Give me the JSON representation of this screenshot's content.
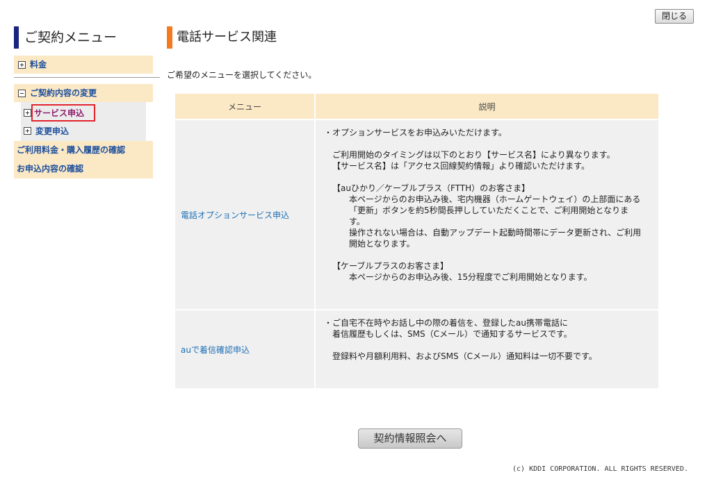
{
  "header": {
    "close_label": "閉じる"
  },
  "sidebar": {
    "title": "ご契約メニュー",
    "items": [
      {
        "label": "料金",
        "toggle": "plus"
      },
      {
        "label": "ご契約内容の変更",
        "toggle": "minus"
      }
    ],
    "sub_items": [
      {
        "label": "サービス申込",
        "active": true
      },
      {
        "label": "変更申込",
        "active": false
      }
    ],
    "links": [
      {
        "label": "ご利用料金・購入履歴の確認"
      },
      {
        "label": "お申込内容の確認"
      }
    ]
  },
  "main": {
    "title": "電話サービス関連",
    "instruction": "ご希望のメニューを選択してください。",
    "table": {
      "headers": [
        "メニュー",
        "説明"
      ],
      "rows": [
        {
          "menu": "電話オプションサービス申込",
          "desc": [
            "・オプションサービスをお申込みいただけます。",
            "ご利用開始のタイミングは以下のとおり【サービス名】により異なります。",
            "【サービス名】は「アクセス回線契約情報」より確認いただけます。",
            "【auひかり／ケーブルプラス（FTTH）のお客さま】",
            "本ページからのお申込み後、宅内機器（ホームゲートウェイ）の上部面にある",
            "「更新」ボタンを約5秒間長押ししていただくことで、ご利用開始となりま",
            "す。",
            "操作されない場合は、自動アップデート起動時間帯にデータ更新され、ご利用",
            "開始となります。",
            "【ケーブルプラスのお客さま】",
            "本ページからのお申込み後、15分程度でご利用開始となります。"
          ]
        },
        {
          "menu": "auで着信確認申込",
          "desc": [
            "・ご自宅不在時やお話し中の際の着信を、登録したau携帯電話に",
            "着信履歴もしくは、SMS（Cメール）で通知するサービスです。",
            "登録料や月額利用料、およびSMS（Cメール）通知料は一切不要です。"
          ]
        }
      ]
    },
    "contract_button_label": "契約情報照会へ"
  },
  "footer": {
    "copyright": "(c) KDDI CORPORATION. ALL RIGHTS RESERVED."
  }
}
